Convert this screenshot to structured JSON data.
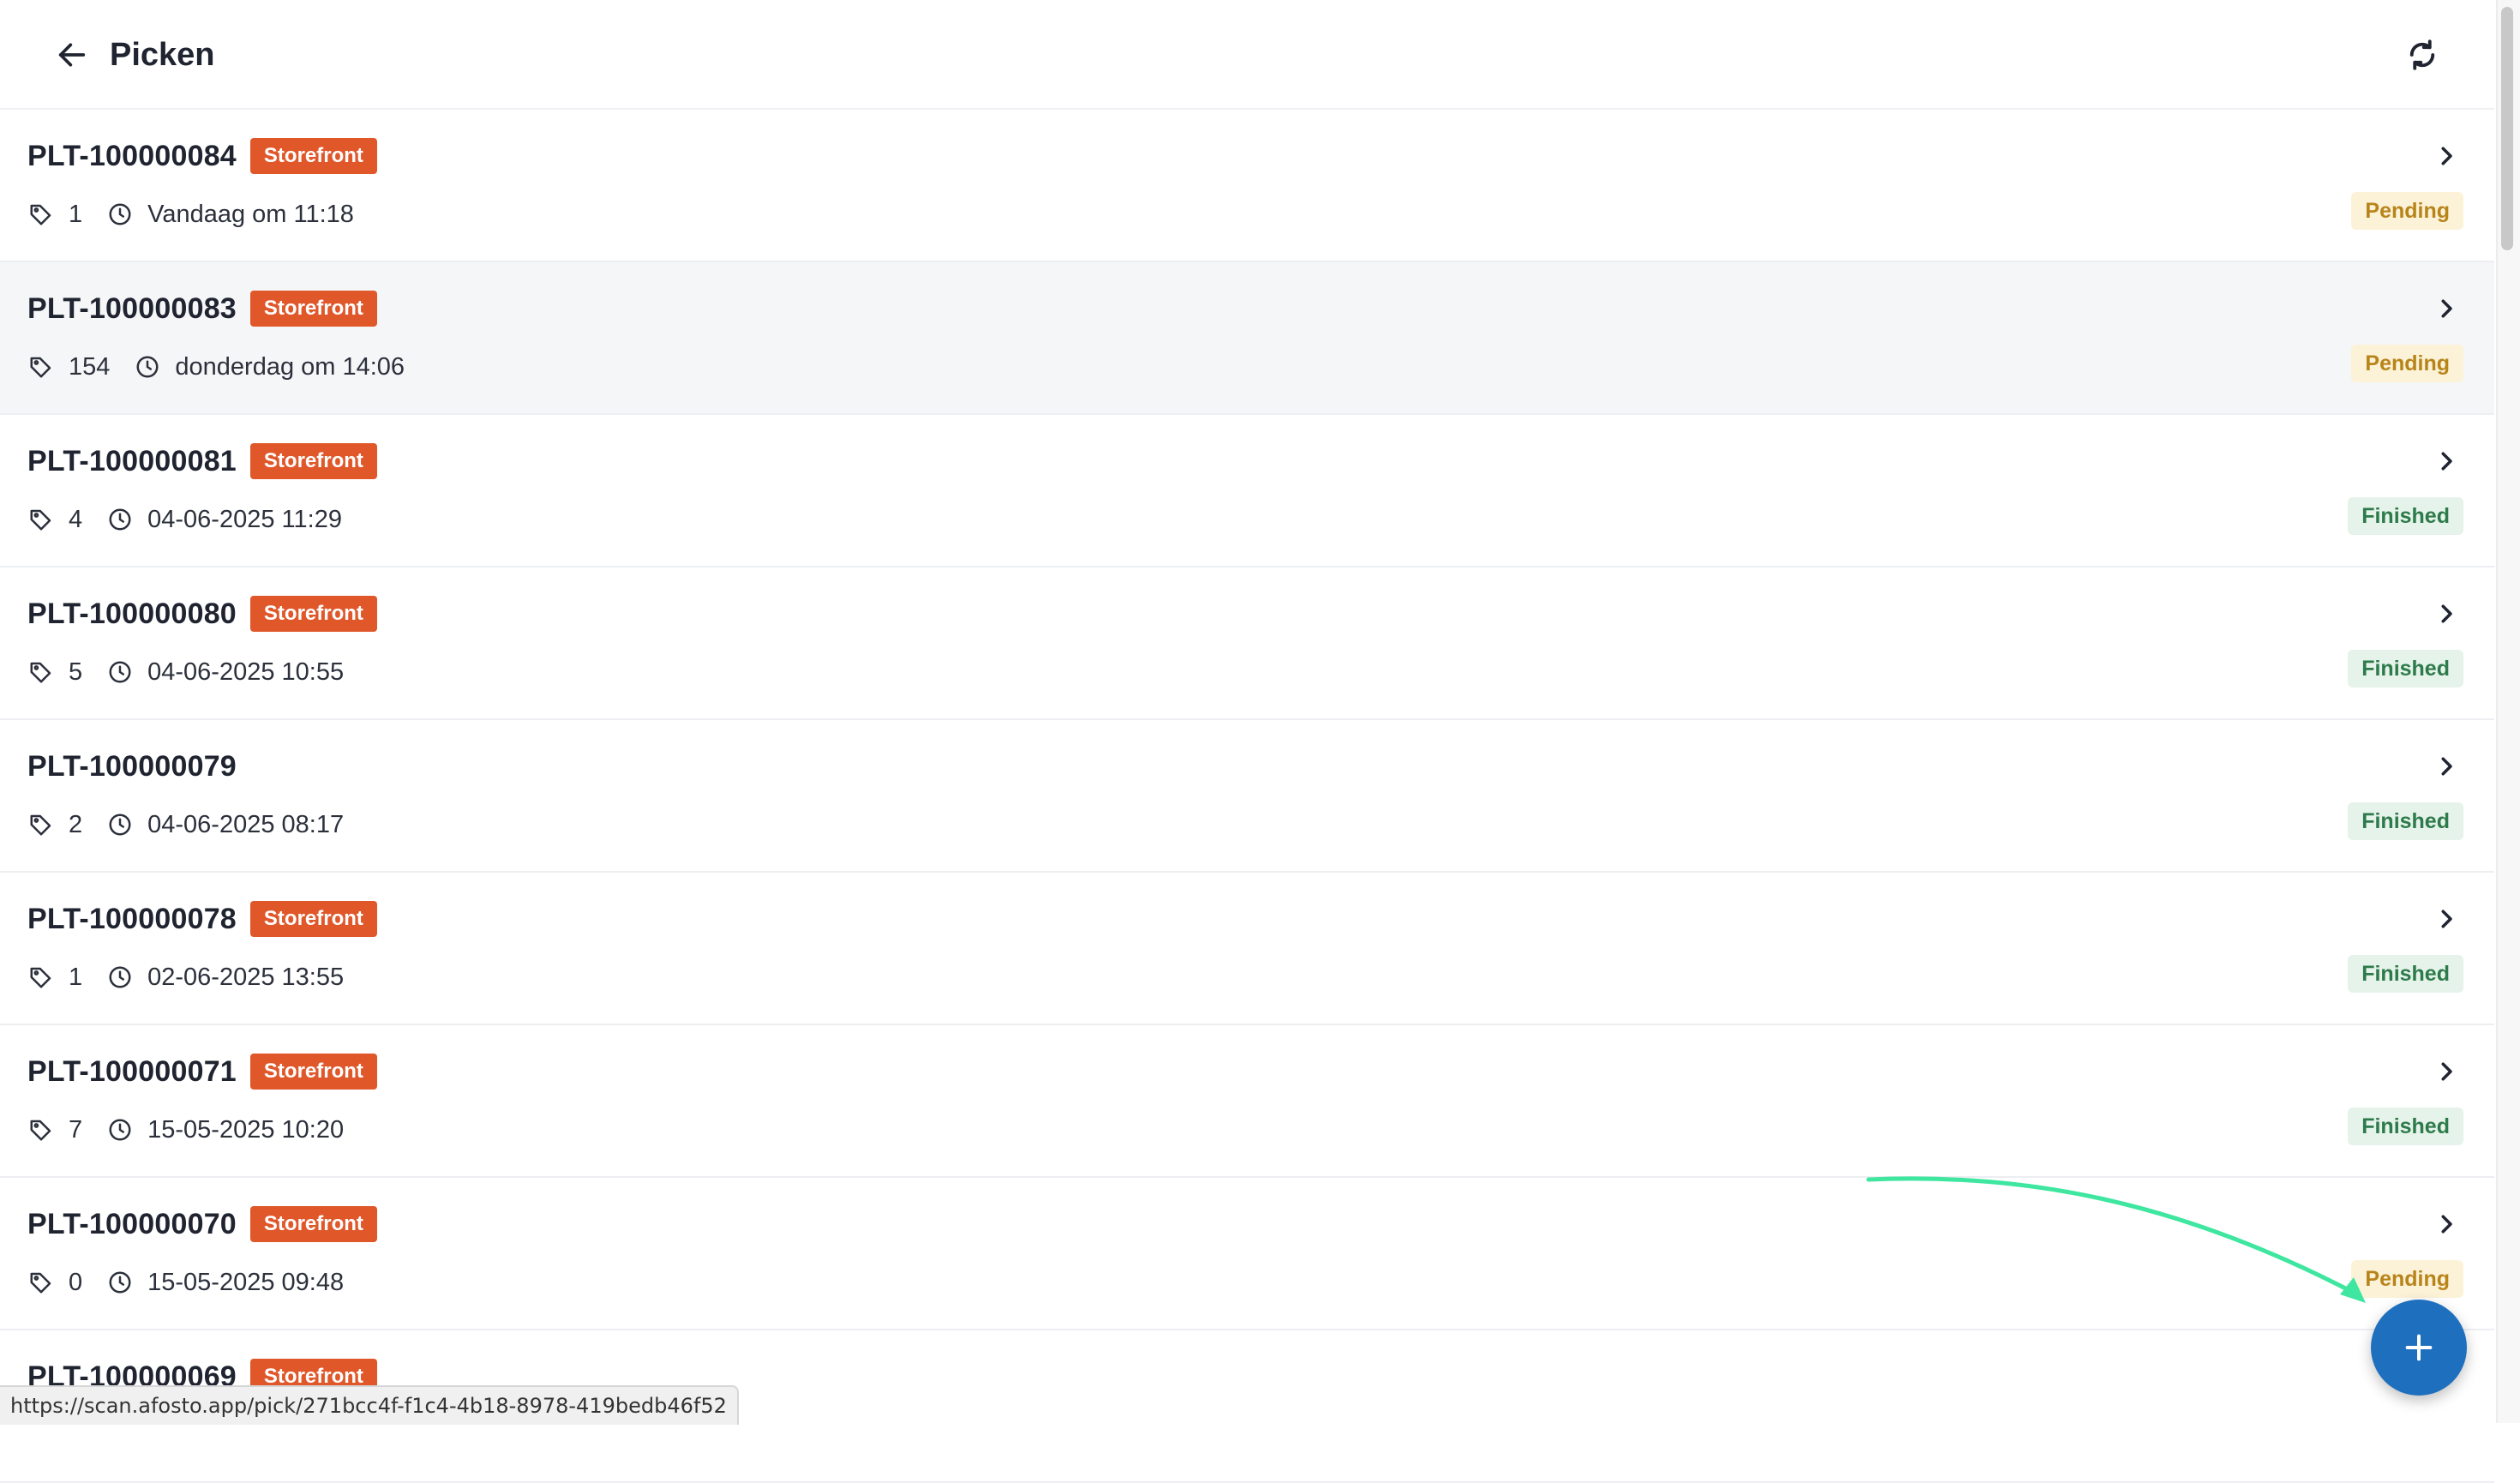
{
  "header": {
    "title": "Picken",
    "back_icon": "arrow-left-icon",
    "sync_icon": "refresh-icon"
  },
  "colors": {
    "channel_badge": "#e0572a",
    "pending_bg": "#fcf2d7",
    "pending_text": "#b8841a",
    "finished_bg": "#e5f3ea",
    "finished_text": "#2d7a4a",
    "fab": "#1f6fbf",
    "annotation_arrow": "#3ee6a0"
  },
  "picklists": [
    {
      "id": "PLT-100000084",
      "channel": "Storefront",
      "items": "1",
      "time": "Vandaag om 11:18",
      "status": "Pending"
    },
    {
      "id": "PLT-100000083",
      "channel": "Storefront",
      "items": "154",
      "time": "donderdag om 14:06",
      "status": "Pending"
    },
    {
      "id": "PLT-100000081",
      "channel": "Storefront",
      "items": "4",
      "time": "04-06-2025 11:29",
      "status": "Finished"
    },
    {
      "id": "PLT-100000080",
      "channel": "Storefront",
      "items": "5",
      "time": "04-06-2025 10:55",
      "status": "Finished"
    },
    {
      "id": "PLT-100000079",
      "channel": "",
      "items": "2",
      "time": "04-06-2025 08:17",
      "status": "Finished"
    },
    {
      "id": "PLT-100000078",
      "channel": "Storefront",
      "items": "1",
      "time": "02-06-2025 13:55",
      "status": "Finished"
    },
    {
      "id": "PLT-100000071",
      "channel": "Storefront",
      "items": "7",
      "time": "15-05-2025 10:20",
      "status": "Finished"
    },
    {
      "id": "PLT-100000070",
      "channel": "Storefront",
      "items": "0",
      "time": "15-05-2025 09:48",
      "status": "Pending"
    },
    {
      "id": "PLT-100000069",
      "channel": "Storefront",
      "items": "",
      "time": "",
      "status": ""
    }
  ],
  "fab": {
    "icon": "plus-icon"
  },
  "status_bar": {
    "url": "https://scan.afosto.app/pick/271bcc4f-f1c4-4b18-8978-419bedb46f52"
  }
}
